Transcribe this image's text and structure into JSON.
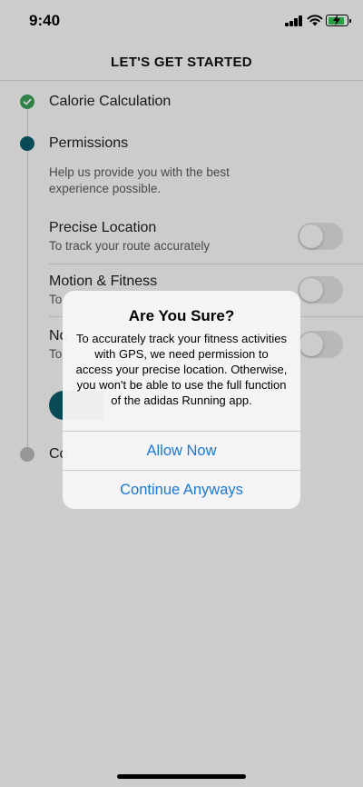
{
  "status_bar": {
    "time": "9:40",
    "icons": [
      "signal-icon",
      "wifi-icon",
      "battery-charging-icon"
    ]
  },
  "header": {
    "title": "LET'S GET STARTED"
  },
  "steps": [
    {
      "label": "Calorie Calculation",
      "state": "done"
    },
    {
      "label": "Permissions",
      "state": "active",
      "description": "Help us provide you with the best experience possible."
    },
    {
      "label": "Co",
      "state": "pending"
    }
  ],
  "permissions": [
    {
      "title": "Precise Location",
      "subtitle": "To track your route accurately",
      "enabled": false
    },
    {
      "title": "Motion & Fitness",
      "subtitle": "To",
      "enabled": false
    },
    {
      "title": "No",
      "subtitle": "To",
      "enabled": false
    }
  ],
  "alert": {
    "title": "Are You Sure?",
    "message": "To accurately track your fitness activities with GPS, we need permission to access your precise location. Otherwise, you won't be able to use the full function of the adidas Running app.",
    "primary_button": "Allow Now",
    "secondary_button": "Continue Anyways"
  },
  "colors": {
    "accent": "#0b5d6b",
    "done": "#3aa35b",
    "link": "#1a78d6",
    "battery": "#34c759"
  }
}
